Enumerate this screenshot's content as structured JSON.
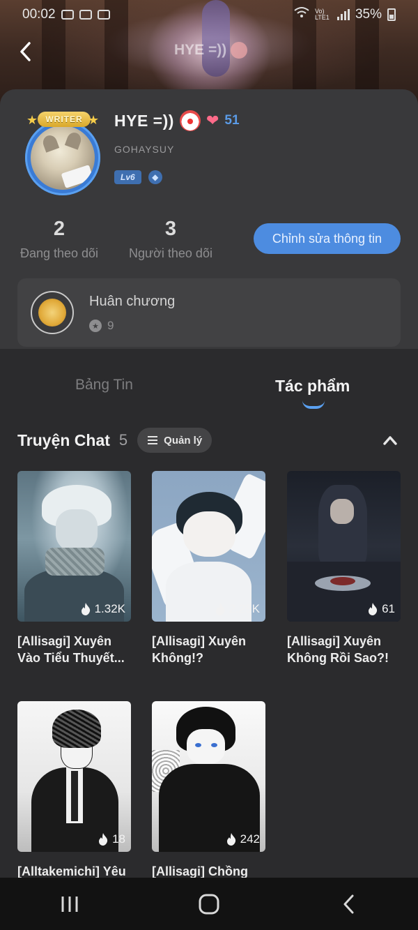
{
  "status_bar": {
    "time": "00:02",
    "network_label": "Vo) LTE1",
    "battery": "35%"
  },
  "header": {
    "banner_title": "HYE =))",
    "back_icon": "chevron-left-icon"
  },
  "profile": {
    "badge": "WRITER",
    "name": "HYE =))",
    "hearts_icon": "two-hearts-icon",
    "fan_count": "51",
    "handle": "GOHAYSUY",
    "level": "Lv6"
  },
  "stats": {
    "following_count": "2",
    "following_label": "Đang theo dõi",
    "followers_count": "3",
    "followers_label": "Người theo dõi",
    "edit_button": "Chỉnh sửa thông tin"
  },
  "medals": {
    "title": "Huân chương",
    "count": "9"
  },
  "tabs": [
    {
      "label": "Bảng Tin",
      "active": false
    },
    {
      "label": "Tác phẩm",
      "active": true
    }
  ],
  "section": {
    "title": "Truyện Chat",
    "count": "5",
    "manage_label": "Quản lý"
  },
  "stories": [
    {
      "title": "[Allisagi] Xuyên Vào Tiểu Thuyết...",
      "views": "1.32K"
    },
    {
      "title": "[Allisagi] Xuyên Không!?",
      "views": "2.25K"
    },
    {
      "title": "[Allisagi] Xuyên Không Rồi Sao?!",
      "views": "61"
    },
    {
      "title": "[Alltakemichi] Yêu",
      "views": "18"
    },
    {
      "title": "[Allisagi] Chồng",
      "views": "242"
    }
  ],
  "colors": {
    "accent": "#4d8ce0",
    "background": "#2b2b2d",
    "card": "#39393b"
  }
}
